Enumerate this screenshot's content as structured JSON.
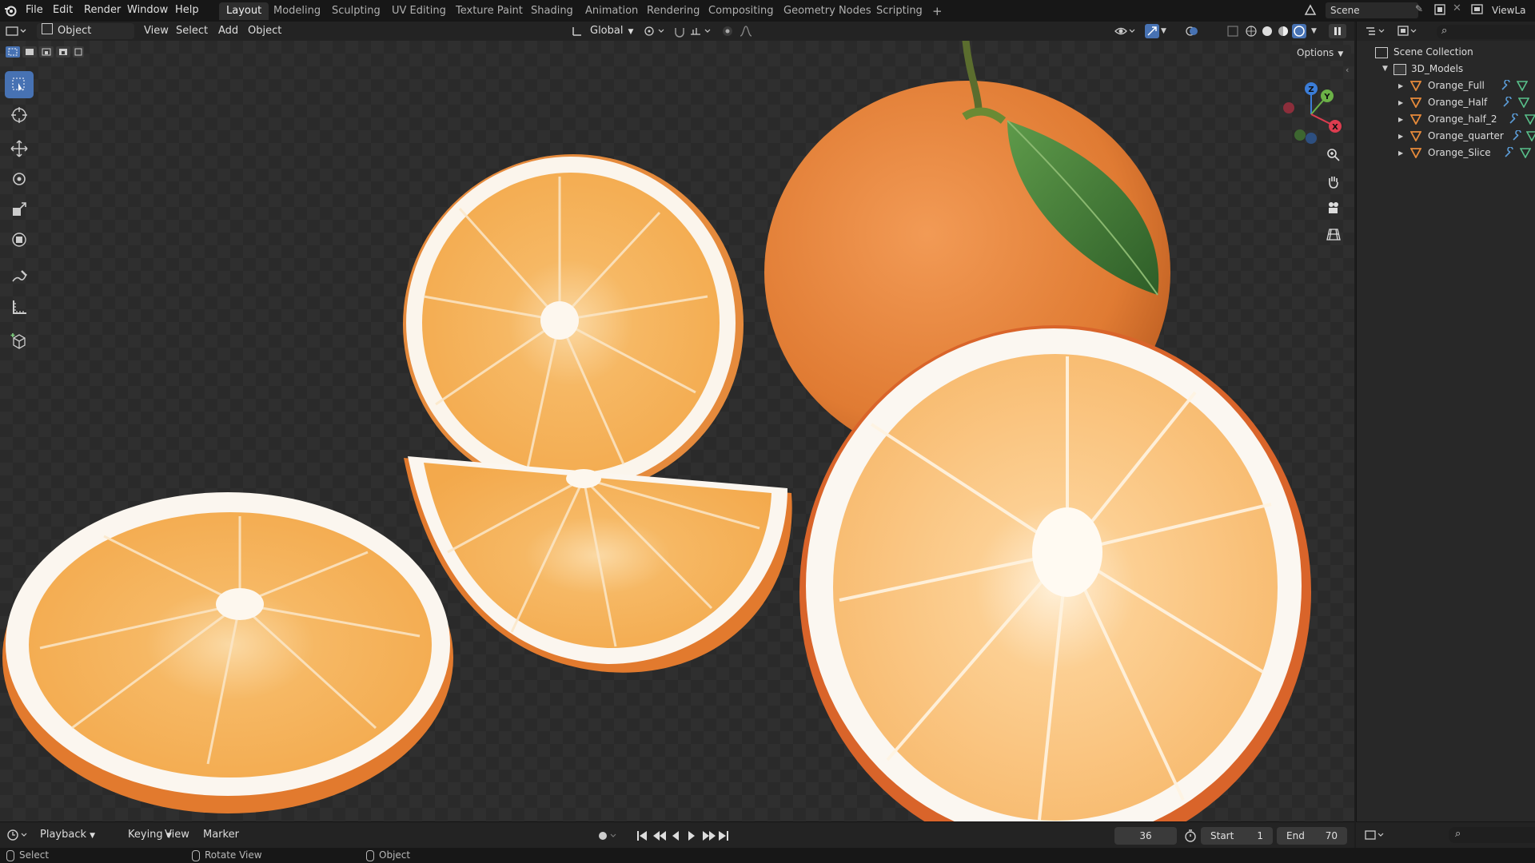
{
  "topbar": {
    "menus": [
      "File",
      "Edit",
      "Render",
      "Window",
      "Help"
    ],
    "workspaces": [
      "Layout",
      "Modeling",
      "Sculpting",
      "UV Editing",
      "Texture Paint",
      "Shading",
      "Animation",
      "Rendering",
      "Compositing",
      "Geometry Nodes",
      "Scripting"
    ],
    "active_workspace": "Layout",
    "add_tab": "+",
    "scene_name": "Scene",
    "view_layer": "ViewLa"
  },
  "viewport_header": {
    "mode": "Object Mode",
    "menus": [
      "View",
      "Select",
      "Add",
      "Object"
    ],
    "transform_orientation": "Global",
    "options_label": "Options"
  },
  "gizmo": {
    "z": "Z",
    "y": "Y",
    "x": "X"
  },
  "outliner": {
    "root": "Scene Collection",
    "collection": "3D_Models",
    "objects": [
      "Orange_Full",
      "Orange_Half",
      "Orange_half_2",
      "Orange_quarter",
      "Orange_Slice"
    ]
  },
  "timeline": {
    "menus": [
      "Playback",
      "Keying",
      "View",
      "Marker"
    ],
    "current_frame": "36",
    "start_label": "Start",
    "start_value": "1",
    "end_label": "End",
    "end_value": "70"
  },
  "statusbar": {
    "left": "Select",
    "middle": "Rotate View",
    "right": "Object"
  },
  "colors": {
    "accent": "#4772b3",
    "orange_peel": "#e9823a",
    "orange_flesh": "#f5ac4f",
    "leaf": "#3f7a36"
  }
}
